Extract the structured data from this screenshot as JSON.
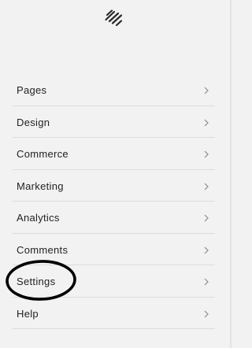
{
  "brand": {
    "logo_icon": "squarespace-logo-icon"
  },
  "menu": {
    "items": [
      {
        "label": "Pages",
        "icon": "chevron-right-icon"
      },
      {
        "label": "Design",
        "icon": "chevron-right-icon"
      },
      {
        "label": "Commerce",
        "icon": "chevron-right-icon"
      },
      {
        "label": "Marketing",
        "icon": "chevron-right-icon"
      },
      {
        "label": "Analytics",
        "icon": "chevron-right-icon"
      },
      {
        "label": "Comments",
        "icon": "chevron-right-icon"
      },
      {
        "label": "Settings",
        "icon": "chevron-right-icon",
        "highlighted": true
      },
      {
        "label": "Help",
        "icon": "chevron-right-icon"
      }
    ]
  },
  "colors": {
    "background": "#f2f2f2",
    "text": "#222222",
    "divider": "#dcdcdc",
    "chevron": "#8c8c8c",
    "annotation_circle": "#000000"
  }
}
